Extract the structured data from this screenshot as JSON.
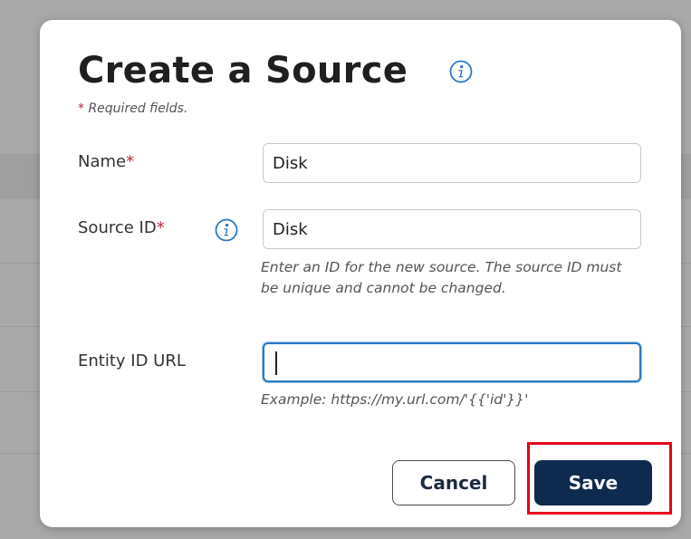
{
  "dialog": {
    "title": "Create a Source",
    "required_note_star": "*",
    "required_note_text": "Required fields."
  },
  "fields": {
    "name": {
      "label": "Name",
      "required_mark": "*",
      "value": "Disk"
    },
    "source_id": {
      "label": "Source ID",
      "required_mark": "*",
      "value": "Disk",
      "help": "Enter an ID for the new source. The source ID must be unique and cannot be changed."
    },
    "entity_id_url": {
      "label": "Entity ID URL",
      "value": "",
      "help": "Example: https://my.url.com/'{{'id'}}'"
    }
  },
  "buttons": {
    "cancel": "Cancel",
    "save": "Save"
  },
  "icons": {
    "info": "info-icon"
  },
  "colors": {
    "accent": "#2b79c2",
    "primary_button": "#0e2a4e",
    "required": "#c2243c",
    "highlight": "#e3001b"
  }
}
